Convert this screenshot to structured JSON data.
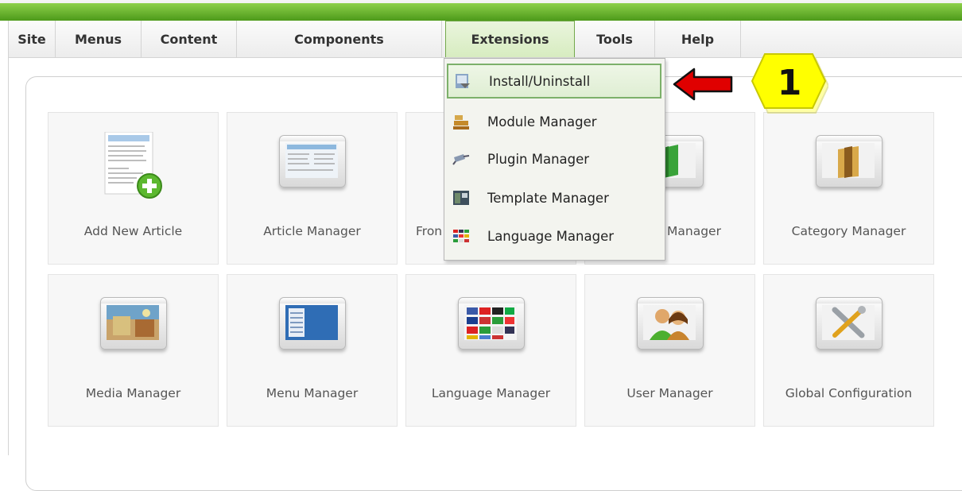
{
  "menu": {
    "items": [
      {
        "label": "Site"
      },
      {
        "label": "Menus"
      },
      {
        "label": "Content"
      },
      {
        "label": "Components"
      },
      {
        "label": "Extensions"
      },
      {
        "label": "Tools"
      },
      {
        "label": "Help"
      }
    ],
    "active": "Extensions"
  },
  "dropdown": {
    "items": [
      {
        "label": "Install/Uninstall",
        "icon": "install-icon",
        "highlighted": true
      },
      {
        "label": "Module Manager",
        "icon": "module-icon"
      },
      {
        "label": "Plugin Manager",
        "icon": "plugin-icon"
      },
      {
        "label": "Template Manager",
        "icon": "template-icon"
      },
      {
        "label": "Language Manager",
        "icon": "language-icon"
      }
    ]
  },
  "tiles": {
    "row1": [
      {
        "label": "Add New Article",
        "icon": "add-article-icon"
      },
      {
        "label": "Article Manager",
        "icon": "article-manager-icon"
      },
      {
        "label": "Fron",
        "icon": "frontpage-manager-icon"
      },
      {
        "label": "Manager",
        "icon": "section-manager-icon"
      },
      {
        "label": "Category Manager",
        "icon": "category-manager-icon"
      }
    ],
    "row2": [
      {
        "label": "Media Manager",
        "icon": "media-manager-icon"
      },
      {
        "label": "Menu Manager",
        "icon": "menu-manager-icon"
      },
      {
        "label": "Language Manager",
        "icon": "language-manager-icon"
      },
      {
        "label": "User Manager",
        "icon": "user-manager-icon"
      },
      {
        "label": "Global Configuration",
        "icon": "global-configuration-icon"
      }
    ]
  },
  "annotation": {
    "step_number": "1",
    "arrow_color": "#e00000",
    "badge_color": "#ffff00"
  },
  "colors": {
    "green_bar": "#5aa423",
    "highlight_border": "#7cb06a"
  }
}
